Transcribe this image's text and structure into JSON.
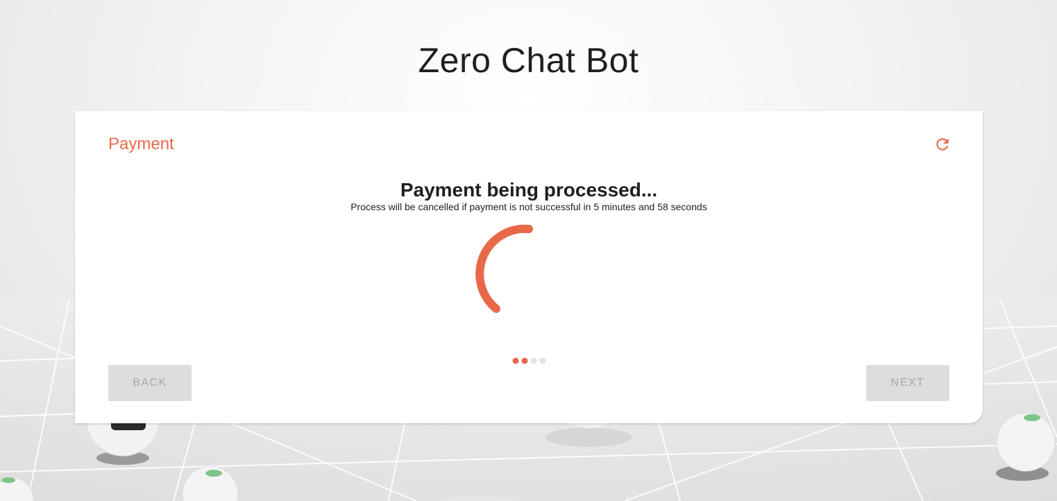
{
  "app": {
    "title": "Zero Chat Bot"
  },
  "payment_card": {
    "title": "Payment",
    "refresh_icon": "refresh-icon",
    "status_heading": "Payment being processed...",
    "status_message": "Process will be cancelled if payment is not successful in 5 minutes and 58 seconds",
    "spinner_icon": "loading-spinner",
    "stepper": {
      "total_steps": 4,
      "completed_steps": 2
    },
    "back_button": {
      "label": "Back",
      "enabled": false
    },
    "next_button": {
      "label": "Next",
      "enabled": false
    }
  },
  "colors": {
    "accent": "#e8694a",
    "step_active": "#e8694a",
    "step_inactive": "#e3e3e3",
    "button_disabled_bg": "#dddddd",
    "button_disabled_text": "#a6a6a6",
    "text_primary": "#1f1f1f"
  }
}
